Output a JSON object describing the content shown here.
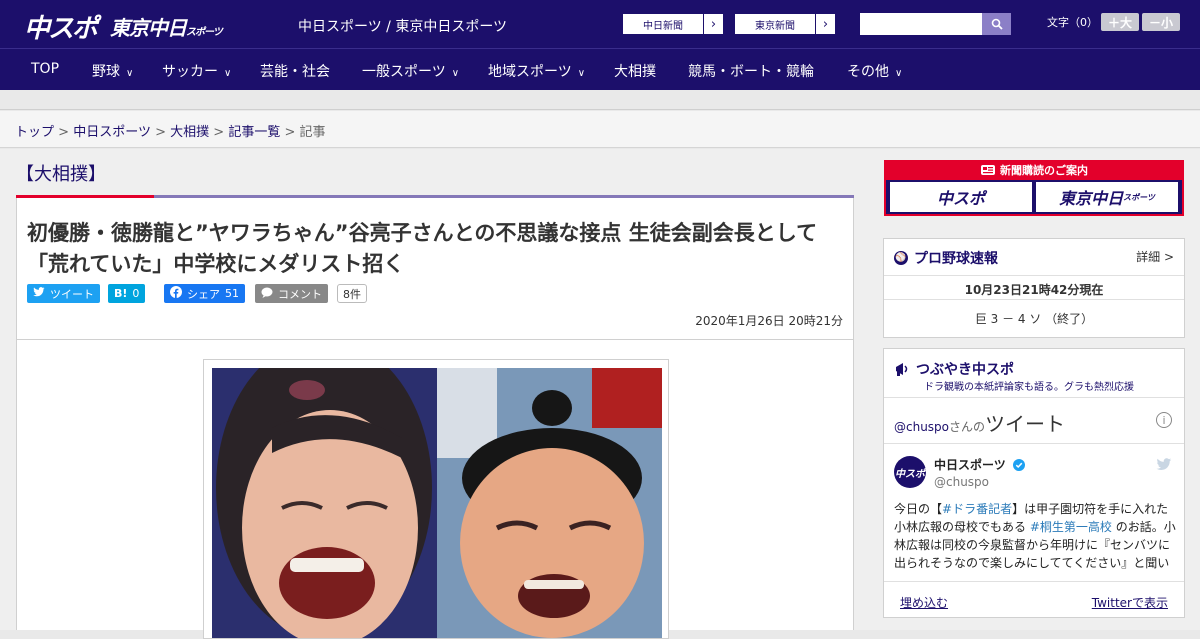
{
  "header": {
    "logo_main": "中スポ",
    "logo_sub": "東京中日",
    "logo_sub_small": "スポーツ",
    "site_links": "中日スポーツ / 東京中日スポーツ",
    "ext_links": [
      {
        "label": "中日新聞",
        "arrow": "›"
      },
      {
        "label": "東京新聞",
        "arrow": "›"
      }
    ],
    "search_placeholder": "",
    "font_size_label": "文字（0）",
    "font_bigger": "＋大",
    "font_smaller": "－小"
  },
  "nav": {
    "items": [
      {
        "label": "TOP",
        "has_menu": false
      },
      {
        "label": "野球",
        "has_menu": true
      },
      {
        "label": "サッカー",
        "has_menu": true
      },
      {
        "label": "芸能・社会",
        "has_menu": false
      },
      {
        "label": "一般スポーツ",
        "has_menu": true
      },
      {
        "label": "地域スポーツ",
        "has_menu": true
      },
      {
        "label": "大相撲",
        "has_menu": false
      },
      {
        "label": "競馬・ボート・競輪",
        "has_menu": false
      },
      {
        "label": "その他",
        "has_menu": true
      }
    ],
    "chevron": "∨"
  },
  "breadcrumb": {
    "items": [
      "トップ",
      "中日スポーツ",
      "大相撲",
      "記事一覧"
    ],
    "current": "記事",
    "separator": ">"
  },
  "article": {
    "category": "【大相撲】",
    "headline": "初優勝・徳勝龍と”ヤワラちゃん”谷亮子さんとの不思議な接点 生徒会副会長として「荒れていた」中学校にメダリスト招く",
    "share": {
      "tweet": "ツイート",
      "hatena_icon": "B!",
      "hatena_count": "0",
      "facebook": "シェア",
      "facebook_count": "51",
      "comment": "コメント",
      "comment_count": "8件"
    },
    "date": "2020年1月26日 20時21分"
  },
  "sidebar": {
    "ad_title": "新聞購読のご案内",
    "ad_logo1": "中スポ",
    "ad_logo2": "東京中日",
    "ad_logo2_small": "スポーツ",
    "baseball": {
      "title": "プロ野球速報",
      "more": "詳細 >",
      "timestamp": "10月23日21時42分現在",
      "score": "巨 3 － 4 ソ （終了）"
    },
    "tweets": {
      "title": "つぶやき中スポ",
      "subtitle": "ドラ観戦の本紙評論家も語る。グラも熱烈応援",
      "header_user": "@chuspo",
      "header_suffix": "さんの",
      "header_big": "ツイート",
      "info": "i",
      "avatar_text": "中スポ",
      "name": "中日スポーツ",
      "handle": "@chuspo",
      "text_1": "今日の【",
      "tag_1": "#ドラ番記者",
      "text_2": "】は甲子園切符を手に入れた小林広報の母校でもある",
      "tag_2": "#桐生第一高校",
      "text_3": " のお話。小林広報は同校の今泉監督から年明けに『センバツに出られそうなので楽しみにしててください』と聞い",
      "embed": "埋め込む",
      "view_on": "Twitterで表示"
    }
  },
  "colors": {
    "brand": "#1c0f6b",
    "accent_red": "#e3002b",
    "twitter": "#1da1f2",
    "hatena": "#00a4de",
    "facebook": "#1877f2"
  }
}
